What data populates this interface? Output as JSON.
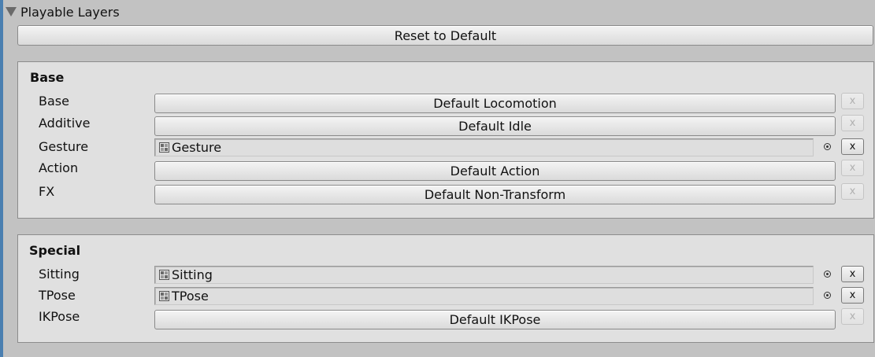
{
  "section": {
    "title": "Playable Layers",
    "reset_label": "Reset to Default"
  },
  "base": {
    "title": "Base",
    "rows": [
      {
        "label": "Base",
        "type": "button",
        "value": "Default Locomotion",
        "remove_label": "x",
        "remove_enabled": false
      },
      {
        "label": "Additive",
        "type": "button",
        "value": "Default Idle",
        "remove_label": "x",
        "remove_enabled": false
      },
      {
        "label": "Gesture",
        "type": "object",
        "value": "Gesture",
        "icon": "animator-controller-icon",
        "remove_label": "x",
        "remove_enabled": true
      },
      {
        "label": "Action",
        "type": "button",
        "value": "Default Action",
        "remove_label": "x",
        "remove_enabled": false
      },
      {
        "label": "FX",
        "type": "button",
        "value": "Default Non-Transform",
        "remove_label": "x",
        "remove_enabled": false
      }
    ]
  },
  "special": {
    "title": "Special",
    "rows": [
      {
        "label": "Sitting",
        "type": "object",
        "value": "Sitting",
        "icon": "animator-controller-icon",
        "remove_label": "x",
        "remove_enabled": true
      },
      {
        "label": "TPose",
        "type": "object",
        "value": "TPose",
        "icon": "animator-controller-icon",
        "remove_label": "x",
        "remove_enabled": true
      },
      {
        "label": "IKPose",
        "type": "button",
        "value": "Default IKPose",
        "remove_label": "x",
        "remove_enabled": false
      }
    ]
  },
  "colors": {
    "background": "#c2c2c2",
    "panel": "#e0e0e0",
    "selection_edge": "#4a7fb0"
  }
}
